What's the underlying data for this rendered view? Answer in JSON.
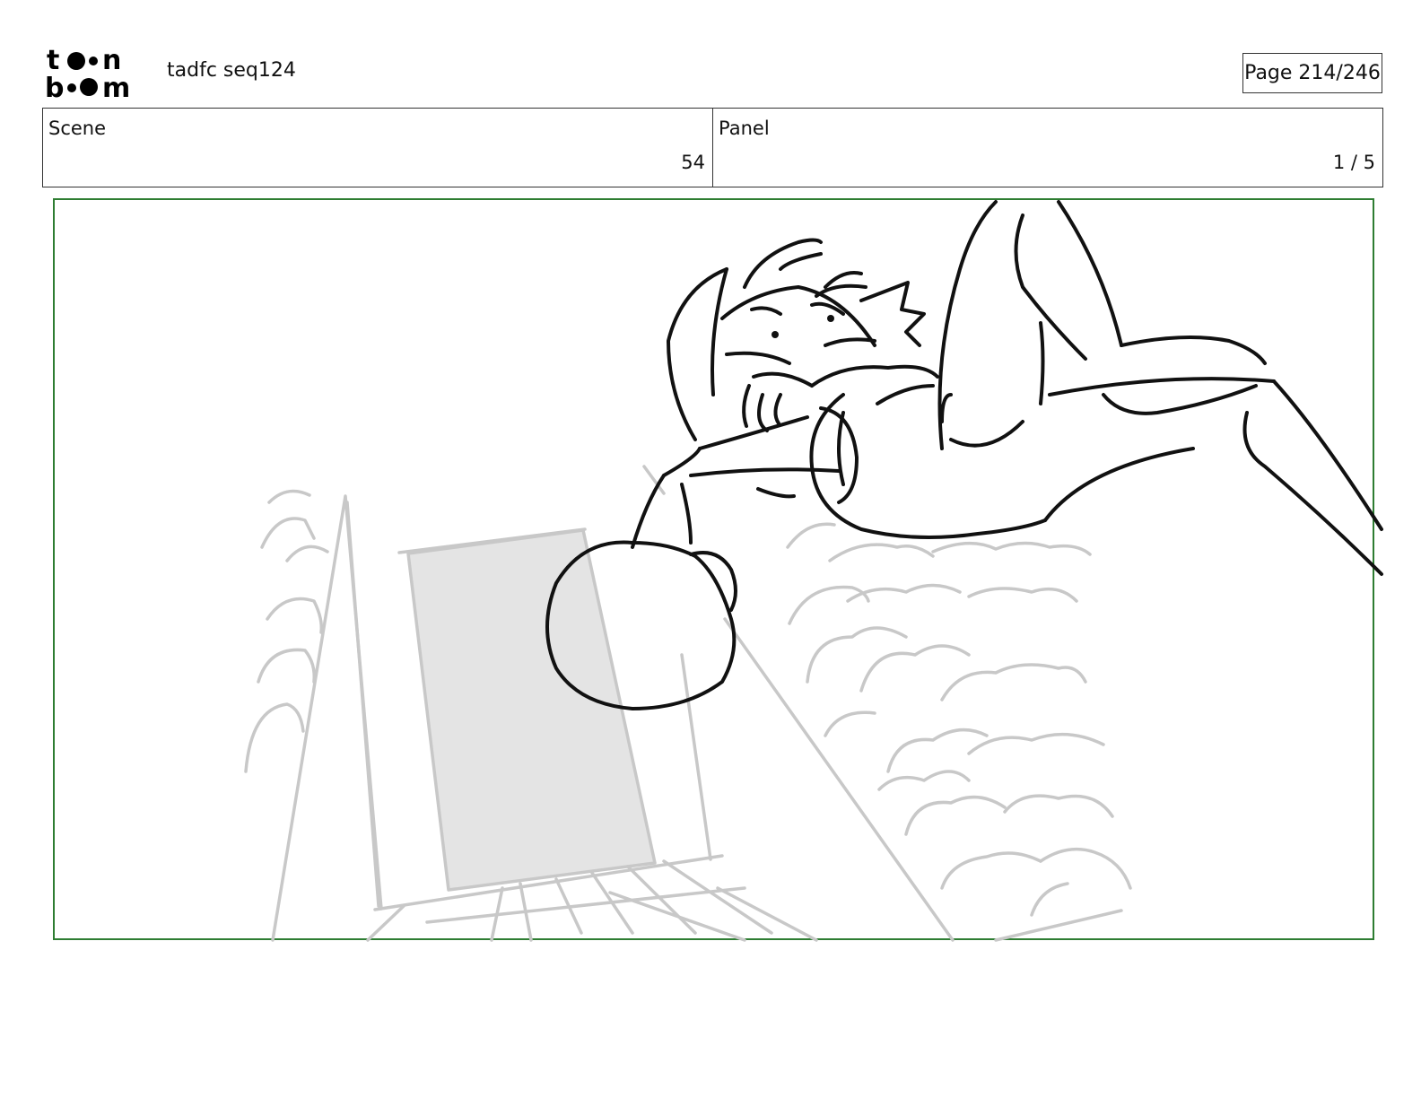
{
  "header": {
    "logo_text": "toon boom",
    "title": "tadfc seq124",
    "page": "Page 214/246"
  },
  "info": {
    "scene_label": "Scene",
    "scene_value": "54",
    "panel_label": "Panel",
    "panel_value": "1 / 5"
  },
  "colors": {
    "frame_border": "#2e7d32",
    "background_sketch": "#c8c8c8",
    "foreground_sketch": "#111111",
    "door_fill": "#e4e4e4"
  }
}
